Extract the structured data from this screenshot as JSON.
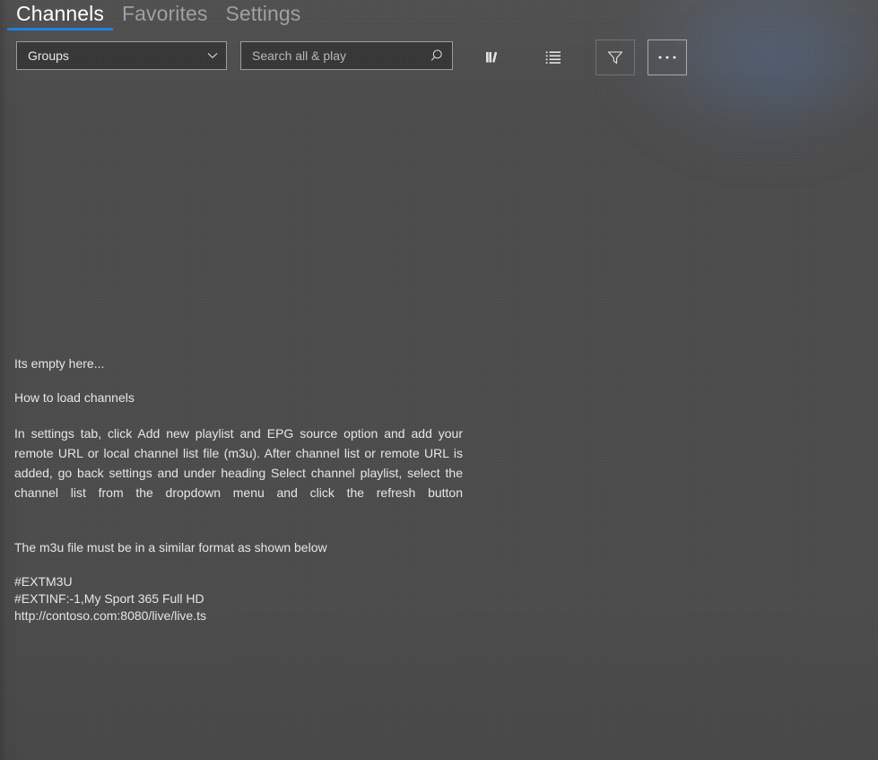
{
  "window": {
    "background_color": "#4a4a4a",
    "accent_color": "#1a7fe0",
    "text_color": "#e6e6e6"
  },
  "tabs": [
    {
      "label": "Channels",
      "active": true,
      "name": "tab-channels"
    },
    {
      "label": "Favorites",
      "active": false,
      "name": "tab-favorites"
    },
    {
      "label": "Settings",
      "active": false,
      "name": "tab-settings"
    }
  ],
  "toolbar": {
    "group_dropdown": {
      "selected": "Groups",
      "icon": "chevron-down-icon"
    },
    "search": {
      "value": "",
      "placeholder": "Search all & play",
      "icon": "search-icon"
    },
    "buttons": [
      {
        "name": "library-button",
        "icon": "library-icon",
        "state": "flat"
      },
      {
        "name": "list-view-button",
        "icon": "list-icon",
        "state": "flat"
      },
      {
        "name": "filter-button",
        "icon": "filter-icon",
        "state": "bordered"
      },
      {
        "name": "more-options-button",
        "icon": "ellipsis-icon",
        "state": "focused"
      }
    ]
  },
  "empty_state": {
    "heading": "Its empty here...",
    "subheading": "How to load  channels",
    "instructions": "In settings tab, click Add new playlist and EPG source  option and add your remote URL or local channel list file (m3u). After channel list or remote URL is added, go back settings and under heading  Select channel playlist, select the channel list from the dropdown menu and click the refresh button",
    "format_note": "The m3u file must be in a similar format as shown below",
    "sample": {
      "line1": "#EXTM3U",
      "line2": "#EXTINF:-1,My Sport 365 Full HD",
      "line3": "http://contoso.com:8080/live/live.ts"
    }
  }
}
